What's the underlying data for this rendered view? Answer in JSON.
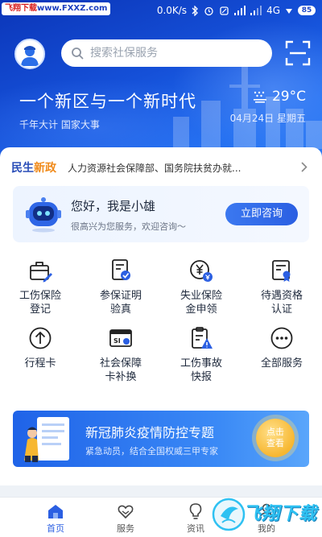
{
  "status": {
    "watermark_text": "飞翔下载",
    "watermark_url": "www.FXXZ.com",
    "speed": "0.0K/s",
    "network": "4G",
    "battery": "85"
  },
  "header": {
    "search_placeholder": "搜索社保服务",
    "slogan": "一个新区与一个新时代",
    "subslogan": "千年大计 国家大事",
    "temperature": "29°C",
    "date": "04月24日 星期五"
  },
  "news": {
    "tag_part1": "民生",
    "tag_part2": "新政",
    "headline": "人力资源社会保障部、国务院扶贫办就..."
  },
  "assistant": {
    "greeting": "您好，我是小雄",
    "subtitle": "很高兴为您服务，欢迎咨询～",
    "button": "立即咨询"
  },
  "services": [
    {
      "label": "工伤保险\n登记",
      "icon": "briefcase-edit-icon"
    },
    {
      "label": "参保证明\n验真",
      "icon": "certificate-check-icon"
    },
    {
      "label": "失业保险\n金申领",
      "icon": "coin-yen-icon"
    },
    {
      "label": "待遇资格\n认证",
      "icon": "badge-document-icon"
    },
    {
      "label": "行程卡",
      "icon": "arrow-up-circle-icon"
    },
    {
      "label": "社会保障\n卡补换",
      "icon": "si-card-icon"
    },
    {
      "label": "工伤事故\n快报",
      "icon": "clipboard-warning-icon"
    },
    {
      "label": "全部服务",
      "icon": "more-dots-icon"
    }
  ],
  "banner": {
    "title": "新冠肺炎疫情防控专题",
    "subtitle": "紧急动员，结合全国权威三甲专家",
    "button": "点击\n查看"
  },
  "tabs": [
    {
      "label": "首页",
      "icon": "home-icon",
      "active": true
    },
    {
      "label": "服务",
      "icon": "heart-hands-icon",
      "active": false
    },
    {
      "label": "资讯",
      "icon": "bulb-icon",
      "active": false
    },
    {
      "label": "我的",
      "icon": "user-icon",
      "active": false
    }
  ],
  "bottom_watermark": "飞翔下载",
  "colors": {
    "primary": "#2b5fe2",
    "hero_dark": "#0b35b8",
    "accent_orange": "#f08a1a"
  }
}
